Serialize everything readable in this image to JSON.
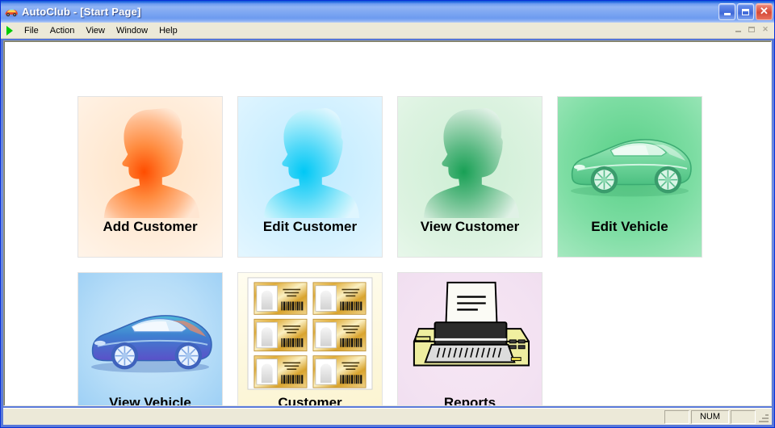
{
  "window": {
    "app_name": "AutoClub",
    "document_title": "[Start Page]",
    "title_full": "AutoClub - [Start Page]",
    "title_icon": "car-icon",
    "controls": {
      "minimize": "minimize-button",
      "maximize": "maximize-button",
      "close": "close-button",
      "close_glyph": "✕"
    }
  },
  "menubar": {
    "mdi_icon": "green-triangle-icon",
    "items": [
      {
        "label": "File"
      },
      {
        "label": "Action"
      },
      {
        "label": "View"
      },
      {
        "label": "Window"
      },
      {
        "label": "Help"
      }
    ],
    "mdi_controls": {
      "restore_title": "Restore Window",
      "close_glyph": "✕"
    }
  },
  "tiles": [
    {
      "label": "Add Customer",
      "art": "person-silhouette",
      "accent": "#ff7f2a",
      "bg_class": "bg-orange"
    },
    {
      "label": "Edit Customer",
      "art": "person-silhouette",
      "accent": "#28c8f0",
      "bg_class": "bg-cyan"
    },
    {
      "label": "View Customer",
      "art": "person-silhouette",
      "accent": "#3aa86a",
      "bg_class": "bg-green"
    },
    {
      "label": "Edit Vehicle",
      "art": "convertible-car",
      "accent": "#2f9c5e",
      "bg_class": "bg-green2"
    },
    {
      "label": "View Vehicle",
      "art": "convertible-car",
      "accent": "#3a63c8",
      "bg_class": "bg-blue"
    },
    {
      "label": "Customer\nCards",
      "art": "membership-cards",
      "accent": "#d8a62b",
      "bg_class": "bg-cream"
    },
    {
      "label": "Reports",
      "art": "dot-matrix-printer",
      "accent": "#efe98a",
      "bg_class": "bg-pink"
    }
  ],
  "statusbar": {
    "message": "",
    "pane_1": "",
    "num_lock": "NUM",
    "pane_3": ""
  },
  "colors": {
    "title_gradient_start": "#0e56d4",
    "title_gradient_mid": "#7fa8f2",
    "menu_bg": "#ece9d8",
    "client_bg": "#ffffff",
    "frame_blue": "#5878d8",
    "close_red": "#d64a37"
  }
}
